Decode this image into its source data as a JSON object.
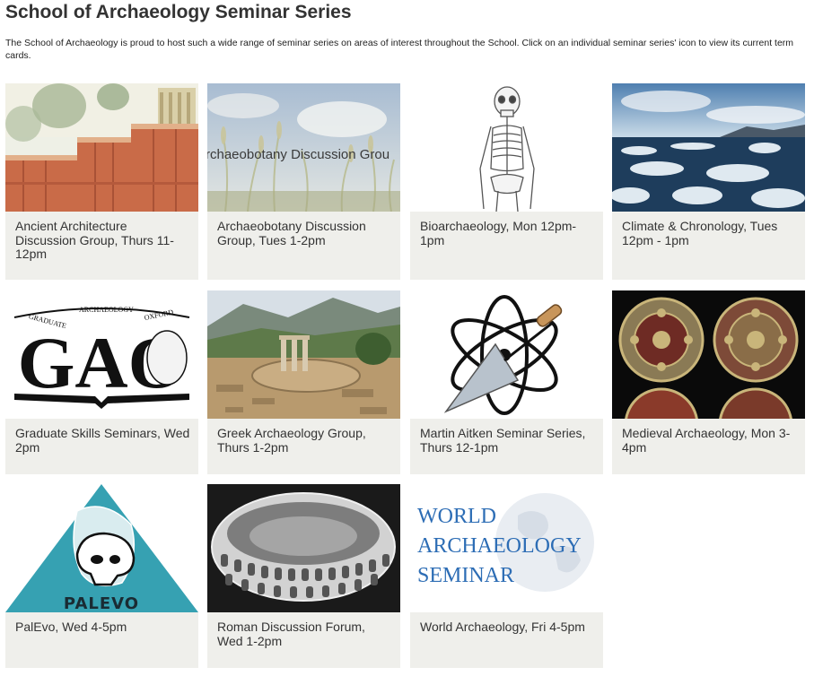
{
  "page": {
    "title": "School of Archaeology Seminar Series",
    "intro": "The School of Archaeology is proud to host such a wide range of seminar series on areas of interest throughout the School.  Click on an individual seminar series' icon to view its current term cards."
  },
  "cards": [
    {
      "caption": "Ancient Architecture Discussion Group, Thurs 11-12pm"
    },
    {
      "caption": "Archaeobotany Discussion Group, Tues 1-2pm",
      "image_text": "rchaeobotany Discussion Grou"
    },
    {
      "caption": "Bioarchaeology, Mon 12pm-1pm"
    },
    {
      "caption": "Climate & Chronology, Tues 12pm - 1pm"
    },
    {
      "caption": "Graduate Skills Seminars, Wed 2pm",
      "logo_text": {
        "main": "GAO",
        "left": "GRADUATE",
        "middle": "ARCHAEOLOGY",
        "right": "OXFORD"
      }
    },
    {
      "caption": "Greek Archaeology Group, Thurs 1-2pm"
    },
    {
      "caption": "Martin Aitken Seminar Series, Thurs 12-1pm"
    },
    {
      "caption": "Medieval Archaeology, Mon 3-4pm"
    },
    {
      "caption": "PalEvo, Wed 4-5pm",
      "logo_text": "PALEVO"
    },
    {
      "caption": "Roman Discussion Forum, Wed 1-2pm"
    },
    {
      "caption": "World Archaeology, Fri 4-5pm",
      "logo_text": {
        "line1": "WORLD",
        "line2": "ARCHAEOLOGY",
        "line3": "SEMINAR"
      }
    }
  ],
  "colors": {
    "card_bg": "#efefeb",
    "title": "#333333",
    "palevo_teal": "#36a1b2",
    "world_blue": "#2d6db5"
  }
}
